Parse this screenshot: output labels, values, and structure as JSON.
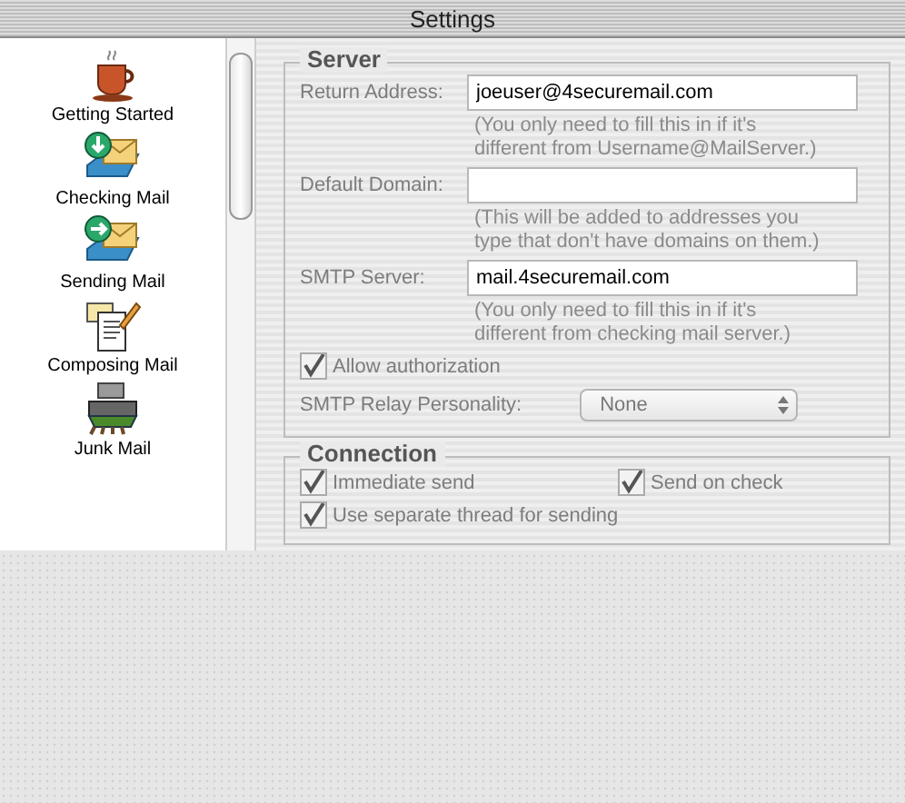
{
  "window": {
    "title": "Settings"
  },
  "sidebar": {
    "items": [
      {
        "label": "Getting Started",
        "kind": "coffee"
      },
      {
        "label": "Checking Mail",
        "kind": "mail-in"
      },
      {
        "label": "Sending Mail",
        "kind": "mail-out"
      },
      {
        "label": "Composing Mail",
        "kind": "compose"
      },
      {
        "label": "Junk Mail",
        "kind": "junk"
      }
    ]
  },
  "server": {
    "title": "Server",
    "fields": [
      {
        "label": "Return Address:",
        "value": "joeuser@4securemail.com",
        "hint_lines": [
          "(You only need to fill this in if it's",
          "different from Username@MailServer.)"
        ]
      },
      {
        "label": "Default Domain:",
        "hint_lines": [
          "(This will be added to addresses you",
          "type that don't have domains on them.)"
        ]
      },
      {
        "label": "SMTP Server:",
        "value": "mail.4securemail.com",
        "hint_lines": [
          "(You only need to fill this in if it's",
          "different from checking mail server.)"
        ]
      }
    ],
    "authorization": {
      "label": "Allow authorization",
      "checked": true
    },
    "relay": {
      "label": "SMTP Relay Personality:",
      "value": "None"
    }
  },
  "connection": {
    "title": "Connection",
    "options": [
      {
        "label": "Immediate send",
        "checked": true
      },
      {
        "label": "Send on check",
        "checked": true
      },
      {
        "label": "Use separate thread for sending",
        "checked": true
      }
    ]
  }
}
